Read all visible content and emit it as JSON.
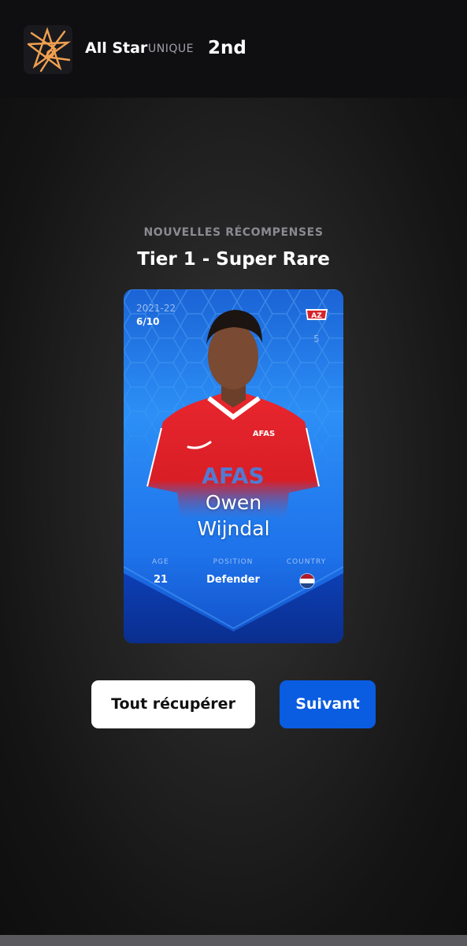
{
  "header": {
    "competition_name": "All Star",
    "competition_tier": "UNIQUE",
    "rank": "2nd",
    "logo_icon": "star-logo-icon"
  },
  "rewards": {
    "label": "NOUVELLES RÉCOMPENSES",
    "tier_title": "Tier 1 - Super Rare"
  },
  "card": {
    "season": "2021-22",
    "serial": "6/10",
    "club_badge_text": "AZ",
    "jersey_number": "5",
    "player_first_name": "Owen",
    "player_last_name": "Wijndal",
    "stats": {
      "age_label": "AGE",
      "age_value": "21",
      "position_label": "POSITION",
      "position_value": "Defender",
      "country_label": "COUNTRY",
      "country_flag": "netherlands-flag-icon"
    },
    "jersey_sponsor": "AFAS",
    "colors": {
      "card_blue": "#1e6fe0",
      "jersey_red": "#e0202a"
    }
  },
  "buttons": {
    "collect_all": "Tout récupérer",
    "next": "Suivant"
  },
  "colors": {
    "accent_blue": "#0a5ce0",
    "logo_orange": "#f0a050"
  }
}
